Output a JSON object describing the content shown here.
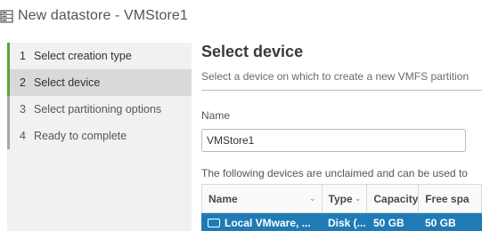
{
  "window": {
    "title": "New datastore - VMStore1"
  },
  "wizard": {
    "steps": [
      {
        "number": "1",
        "label": "Select creation type",
        "state": "done"
      },
      {
        "number": "2",
        "label": "Select device",
        "state": "active"
      },
      {
        "number": "3",
        "label": "Select partitioning options",
        "state": "pending"
      },
      {
        "number": "4",
        "label": "Ready to complete",
        "state": "pending"
      }
    ]
  },
  "main": {
    "heading": "Select device",
    "subtext": "Select a device on which to create a new VMFS partition",
    "name_label": "Name",
    "name_value": "VMStore1",
    "devices_note": "The following devices are unclaimed and can be used to"
  },
  "devices_table": {
    "columns": [
      "Name",
      "Type",
      "Capacity",
      "Free spa"
    ],
    "rows": [
      {
        "name": "Local VMware, ...",
        "type": "Disk (...",
        "capacity": "50 GB",
        "free": "50 GB",
        "selected": true
      }
    ]
  },
  "colors": {
    "step_done": "#5ca23a",
    "step_pending": "#a8a8a8",
    "selected_row": "#1f7bb6"
  },
  "icons": {
    "title": "datastore-icon",
    "row": "disk-icon",
    "sort": "chevron-down-icon"
  }
}
